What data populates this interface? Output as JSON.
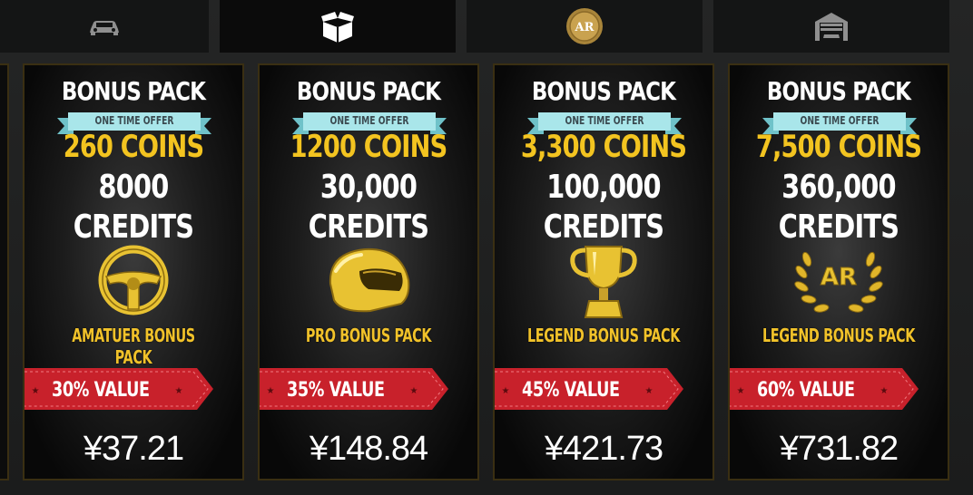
{
  "tabs": [
    {
      "icon": "car-icon",
      "active": false
    },
    {
      "icon": "box-icon",
      "active": true
    },
    {
      "icon": "ar-coin-icon",
      "active": false,
      "coin_text": "AR"
    },
    {
      "icon": "garage-icon",
      "active": false
    }
  ],
  "cards": [
    {
      "title": "BONUS PACK",
      "offer": "ONE TIME OFFER",
      "coins": "260 COINS",
      "credits_amount": "8000",
      "credits_label": "CREDITS",
      "emblem": "steering-wheel-icon",
      "pack_name": "AMATUER BONUS PACK",
      "value": "30% VALUE",
      "price": "¥37.21"
    },
    {
      "title": "BONUS PACK",
      "offer": "ONE TIME OFFER",
      "coins": "1200 COINS",
      "credits_amount": "30,000",
      "credits_label": "CREDITS",
      "emblem": "helmet-icon",
      "pack_name": "PRO BONUS PACK",
      "value": "35% VALUE",
      "price": "¥148.84"
    },
    {
      "title": "BONUS PACK",
      "offer": "ONE TIME OFFER",
      "coins": "3,300 COINS",
      "credits_amount": "100,000",
      "credits_label": "CREDITS",
      "emblem": "trophy-icon",
      "pack_name": "LEGEND BONUS PACK",
      "value": "45% VALUE",
      "price": "¥421.73"
    },
    {
      "title": "BONUS PACK",
      "offer": "ONE TIME OFFER",
      "coins": "7,500 COINS",
      "credits_amount": "360,000",
      "credits_label": "CREDITS",
      "emblem": "ar-laurel-icon",
      "emblem_text": "AR",
      "pack_name": "LEGEND BONUS PACK",
      "value": "60% VALUE",
      "price": "¥731.82"
    }
  ],
  "colors": {
    "gold": "#f3c420",
    "ribbon": "#a9e6ea",
    "value_red": "#c8212b",
    "card_border": "#3a2f12"
  }
}
